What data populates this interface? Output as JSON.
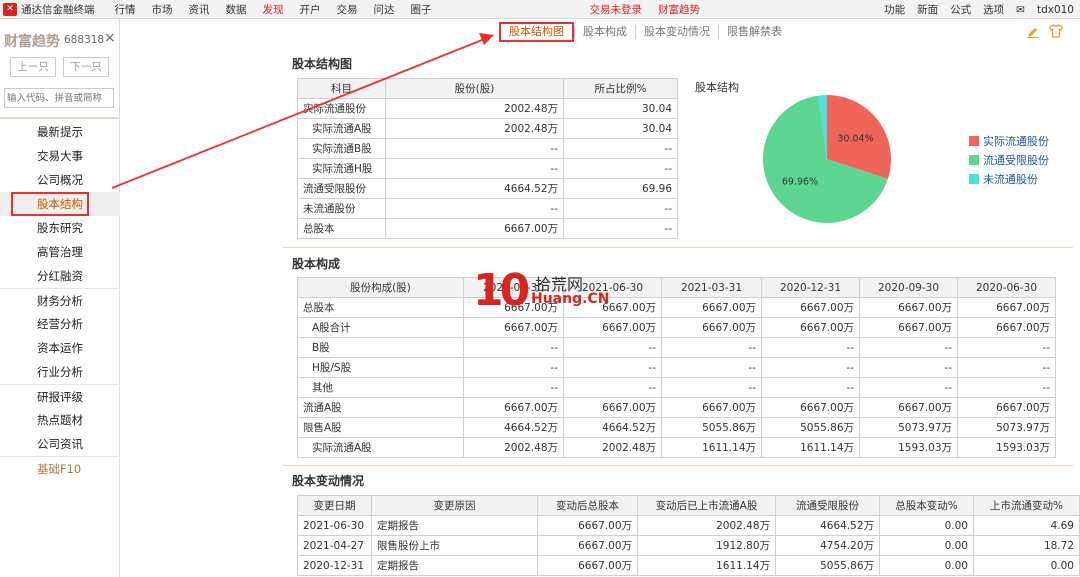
{
  "topbar": {
    "app_name": "通达信金融终端",
    "menus": [
      "行情",
      "市场",
      "资讯",
      "数据",
      "发现",
      "开户",
      "交易",
      "问达",
      "圈子"
    ],
    "status_login": "交易未登录",
    "status_fortune": "财富趋势",
    "right": [
      "功能",
      "新面",
      "公式",
      "选项",
      "tdx010"
    ]
  },
  "sidebar": {
    "title": "财富趋势",
    "code": "688318",
    "close": "×",
    "prev": "上一只",
    "next": "下一只",
    "search_placeholder": "输入代码、拼音或简称",
    "items": [
      "最新提示",
      "交易大事",
      "公司概况",
      "股本结构",
      "股东研究",
      "高管治理",
      "分红融资",
      "财务分析",
      "经营分析",
      "资本运作",
      "行业分析",
      "研报评级",
      "热点题材",
      "公司资讯",
      "基础F10"
    ]
  },
  "tabs": [
    "股本结构图",
    "股本构成",
    "股本变动情况",
    "限售解禁表"
  ],
  "section1": {
    "title": "股本结构图",
    "headers": [
      "科目",
      "股份(股)",
      "所占比例%"
    ],
    "rows": [
      [
        "实际流通股份",
        "2002.48万",
        "30.04"
      ],
      [
        "实际流通A股",
        "2002.48万",
        "30.04"
      ],
      [
        "实际流通B股",
        "--",
        "--"
      ],
      [
        "实际流通H股",
        "--",
        "--"
      ],
      [
        "流通受限股份",
        "4664.52万",
        "69.96"
      ],
      [
        "未流通股份",
        "--",
        "--"
      ],
      [
        "总股本",
        "6667.00万",
        "--"
      ]
    ]
  },
  "chart_data": {
    "type": "pie",
    "title": "股本结构",
    "labels": [
      "实际流通股份",
      "流通受限股份",
      "未流通股份"
    ],
    "values": [
      30.04,
      69.96,
      0
    ],
    "colors": [
      "#f0645a",
      "#5dd692",
      "#4de0dc"
    ],
    "data_labels": [
      "30.04%",
      "69.96%"
    ]
  },
  "section2": {
    "title": "股本构成",
    "headers": [
      "股份构成(股)",
      "2021-09-30",
      "2021-06-30",
      "2021-03-31",
      "2020-12-31",
      "2020-09-30",
      "2020-06-30"
    ],
    "rows": [
      [
        "总股本",
        "6667.00万",
        "6667.00万",
        "6667.00万",
        "6667.00万",
        "6667.00万",
        "6667.00万"
      ],
      [
        "A股合计",
        "6667.00万",
        "6667.00万",
        "6667.00万",
        "6667.00万",
        "6667.00万",
        "6667.00万"
      ],
      [
        "B股",
        "--",
        "--",
        "--",
        "--",
        "--",
        "--"
      ],
      [
        "H股/S股",
        "--",
        "--",
        "--",
        "--",
        "--",
        "--"
      ],
      [
        "其他",
        "--",
        "--",
        "--",
        "--",
        "--",
        "--"
      ],
      [
        "流通A股",
        "6667.00万",
        "6667.00万",
        "6667.00万",
        "6667.00万",
        "6667.00万",
        "6667.00万"
      ],
      [
        "限售A股",
        "4664.52万",
        "4664.52万",
        "5055.86万",
        "5055.86万",
        "5073.97万",
        "5073.97万"
      ],
      [
        "实际流通A股",
        "2002.48万",
        "2002.48万",
        "1611.14万",
        "1611.14万",
        "1593.03万",
        "1593.03万"
      ]
    ]
  },
  "section3": {
    "title": "股本变动情况",
    "headers": [
      "变更日期",
      "变更原因",
      "变动后总股本",
      "变动后已上市流通A股",
      "流通受限股份",
      "总股本变动%",
      "上市流通变动%"
    ],
    "rows": [
      [
        "2021-06-30",
        "定期报告",
        "6667.00万",
        "2002.48万",
        "4664.52万",
        "0.00",
        "4.69"
      ],
      [
        "2021-04-27",
        "限售股份上市",
        "6667.00万",
        "1912.80万",
        "4754.20万",
        "0.00",
        "18.72"
      ],
      [
        "2020-12-31",
        "定期报告",
        "6667.00万",
        "1611.14万",
        "5055.86万",
        "0.00",
        "0.00"
      ]
    ]
  },
  "watermark": {
    "num": "10",
    "cn": "拾荒网",
    "en": "Huang.CN"
  }
}
